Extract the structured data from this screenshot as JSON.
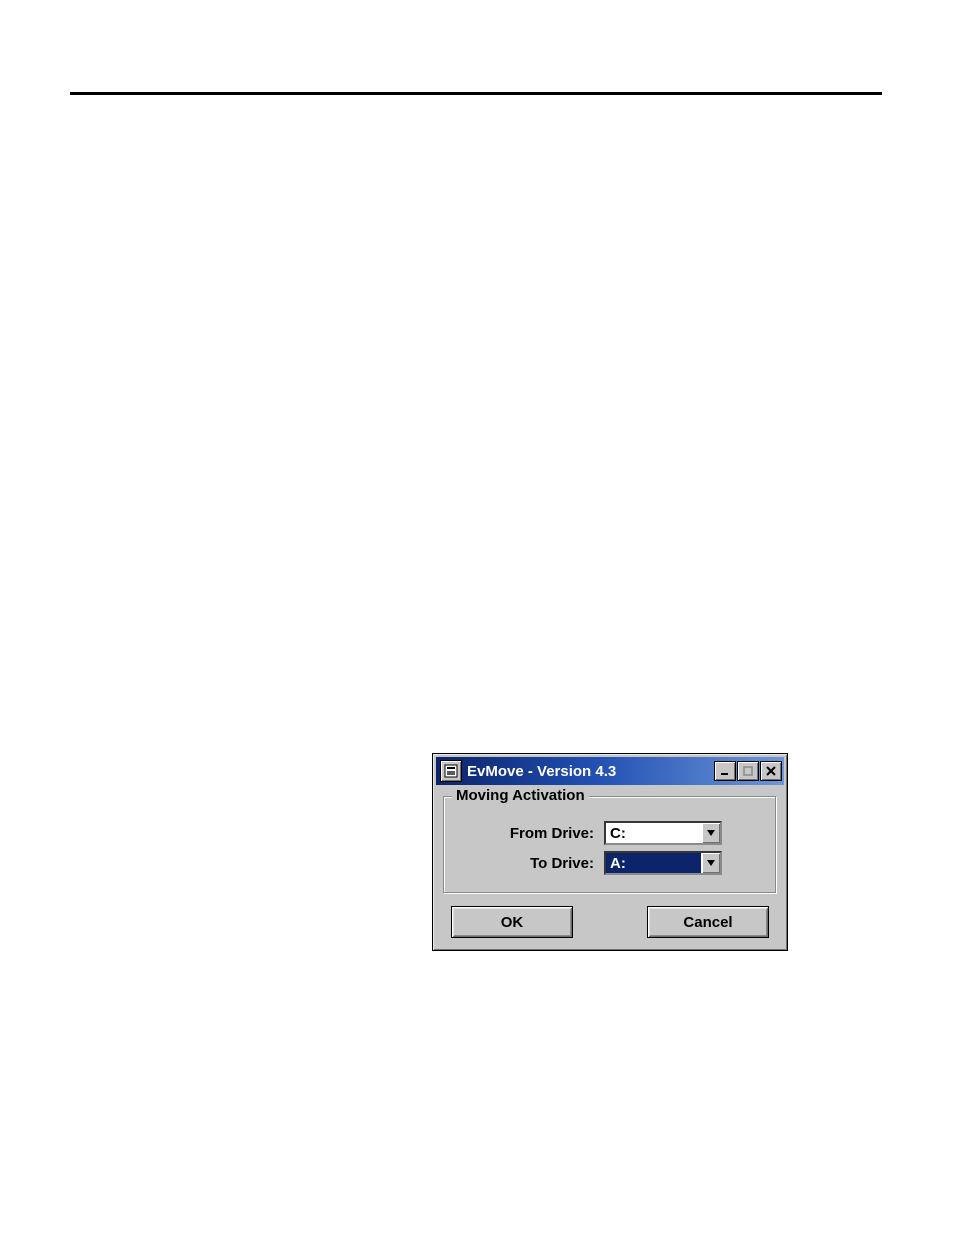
{
  "window": {
    "title": "EvMove - Version 4.3"
  },
  "group": {
    "legend": "Moving Activation",
    "from_label": "From Drive:",
    "to_label": "To Drive:",
    "from_value": "C:",
    "to_value": "A:"
  },
  "buttons": {
    "ok": "OK",
    "cancel": "Cancel"
  },
  "icons": {
    "sysmenu": "app-icon",
    "minimize": "minimize-icon",
    "maximize": "maximize-icon",
    "close": "close-icon",
    "dropdown": "chevron-down-icon"
  }
}
